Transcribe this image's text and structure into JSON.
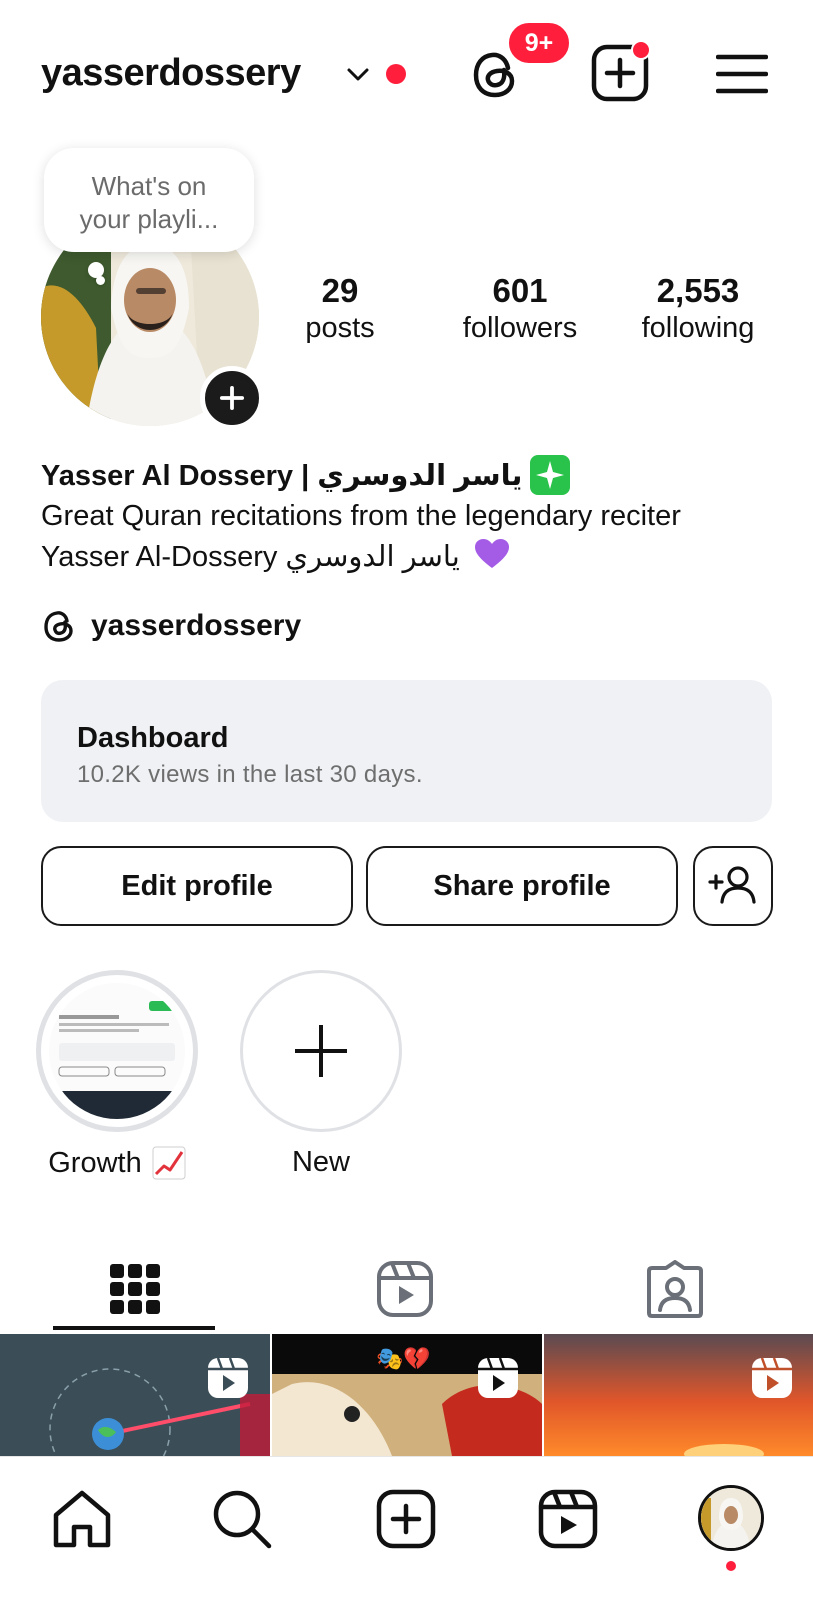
{
  "header": {
    "username": "yasserdossery",
    "notification_badge": "9+",
    "accent_red": "#ff1f3d"
  },
  "note": {
    "text_line1": "What's on",
    "text_line2": "your playli..."
  },
  "stats": {
    "posts_count": "29",
    "posts_label": "posts",
    "followers_count": "601",
    "followers_label": "followers",
    "following_count": "2,553",
    "following_label": "following"
  },
  "profile": {
    "full_name": "Yasser Al Dossery | ياسر الدوسري",
    "bio_line1": "Great Quran recitations from the legendary reciter",
    "bio_line2": "Yasser Al-Dossery ياسر الدوسري",
    "threads_handle": "yasserdossery"
  },
  "dashboard": {
    "title": "Dashboard",
    "subtitle": "10.2K views in the last 30 days."
  },
  "actions": {
    "edit_profile": "Edit profile",
    "share_profile": "Share profile"
  },
  "highlights": [
    {
      "label": "Growth"
    },
    {
      "label": "New"
    }
  ],
  "tabs": [
    {
      "name": "grid-icon"
    },
    {
      "name": "reels-icon"
    },
    {
      "name": "tagged-icon"
    }
  ],
  "bottom_nav": [
    "home-icon",
    "search-icon",
    "create-icon",
    "reels-icon",
    "profile-avatar"
  ]
}
